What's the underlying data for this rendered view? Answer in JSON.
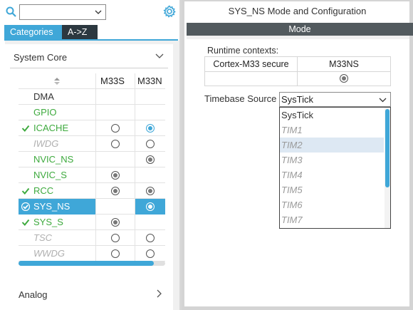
{
  "left": {
    "search": {
      "value": ""
    },
    "tabs": [
      {
        "label": "Categories"
      },
      {
        "label": "A->Z"
      }
    ],
    "section_title": "System Core",
    "columns": [
      "M33S",
      "M33N"
    ],
    "rows": [
      {
        "name": "DMA",
        "style": "dark",
        "checked": false,
        "m33s": "none",
        "m33n": "none"
      },
      {
        "name": "GPIO",
        "style": "green",
        "checked": false,
        "m33s": "none",
        "m33n": "none"
      },
      {
        "name": "ICACHE",
        "style": "green",
        "checked": true,
        "m33s": "radio",
        "m33n": "radio-selected-blue"
      },
      {
        "name": "IWDG",
        "style": "gray",
        "checked": false,
        "m33s": "radio",
        "m33n": "radio"
      },
      {
        "name": "NVIC_NS",
        "style": "green",
        "checked": false,
        "m33s": "none",
        "m33n": "radio-selected"
      },
      {
        "name": "NVIC_S",
        "style": "green",
        "checked": false,
        "m33s": "radio-selected",
        "m33n": "none"
      },
      {
        "name": "RCC",
        "style": "green",
        "checked": true,
        "m33s": "radio-selected",
        "m33n": "radio-selected"
      },
      {
        "name": "SYS_NS",
        "style": "selected",
        "checked": true,
        "m33s": "none",
        "m33n": "radio-selected-white"
      },
      {
        "name": "SYS_S",
        "style": "green",
        "checked": true,
        "m33s": "radio-selected",
        "m33n": "none"
      },
      {
        "name": "TSC",
        "style": "gray",
        "checked": false,
        "m33s": "radio",
        "m33n": "radio"
      },
      {
        "name": "WWDG",
        "style": "gray",
        "checked": false,
        "m33s": "radio",
        "m33n": "radio"
      }
    ],
    "analog_title": "Analog"
  },
  "right": {
    "title": "SYS_NS Mode and Configuration",
    "mode_bar": "Mode",
    "runtime_contexts_label": "Runtime contexts:",
    "ctx_table": {
      "col0": "Cortex-M33 secure",
      "col1": "M33NS"
    },
    "timebase_label": "Timebase Source",
    "timebase_value": "SysTick",
    "options": [
      {
        "label": "SysTick",
        "enabled": true,
        "highlighted": false
      },
      {
        "label": "TIM1",
        "enabled": false,
        "highlighted": false
      },
      {
        "label": "TIM2",
        "enabled": false,
        "highlighted": true
      },
      {
        "label": "TIM3",
        "enabled": false,
        "highlighted": false
      },
      {
        "label": "TIM4",
        "enabled": false,
        "highlighted": false
      },
      {
        "label": "TIM5",
        "enabled": false,
        "highlighted": false
      },
      {
        "label": "TIM6",
        "enabled": false,
        "highlighted": false
      },
      {
        "label": "TIM7",
        "enabled": false,
        "highlighted": false
      }
    ]
  },
  "colors": {
    "accent": "#3fa7d8",
    "check_green": "#3eaa3e",
    "dark_tab": "#2c3840",
    "mode_bar": "#525a5e"
  }
}
